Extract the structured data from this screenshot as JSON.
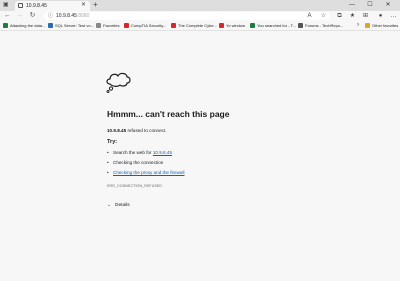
{
  "tab": {
    "title": "10.9.8.45",
    "close": "✕",
    "actions": "▣"
  },
  "new_tab": "+",
  "window_controls": {
    "minimize": "—",
    "maximize": "☐",
    "close": "✕"
  },
  "nav": {
    "back": "←",
    "forward": "→",
    "refresh": "↻"
  },
  "address": {
    "url": "10.9.8.45",
    "port": ":8080",
    "info_icon": "ⓘ"
  },
  "toolbar_icons": [
    "read-aloud-icon",
    "favorites-star-icon",
    "extensions-icon",
    "favorites-icon",
    "collections-icon",
    "profile-icon",
    "more-icon"
  ],
  "bookmarks": [
    {
      "label": "Attacking the data...",
      "icon_color": "#1a7f3c"
    },
    {
      "label": "SQL Server: Test vo...",
      "icon_color": "#2b6cb0"
    },
    {
      "label": "Favorites",
      "icon_color": "#888888"
    },
    {
      "label": "CompTIA Security...",
      "icon_color": "#d62828"
    },
    {
      "label": "The Complete Cybe...",
      "icon_color": "#d62828"
    },
    {
      "label": "Yo window",
      "icon_color": "#d62828"
    },
    {
      "label": "You searched for - T...",
      "icon_color": "#1a7f3c"
    },
    {
      "label": "Forums - TechRepu...",
      "icon_color": "#555555"
    },
    {
      "label": "Other favorites",
      "icon_color": "#e0a526"
    }
  ],
  "bookmarks_more": "›",
  "error": {
    "title": "Hmmm... can't reach this page",
    "host": "10.9.8.45",
    "message_suffix": " refused to connect.",
    "try_heading": "Try:",
    "suggestions": {
      "search_prefix": "Search the web for ",
      "search_link": "10.9.8.45",
      "checking_connection": "Checking the connection",
      "checking_proxy": "Checking the proxy and the firewall"
    },
    "code": "ERR_CONNECTION_REFUSED",
    "details_label": "Details"
  }
}
